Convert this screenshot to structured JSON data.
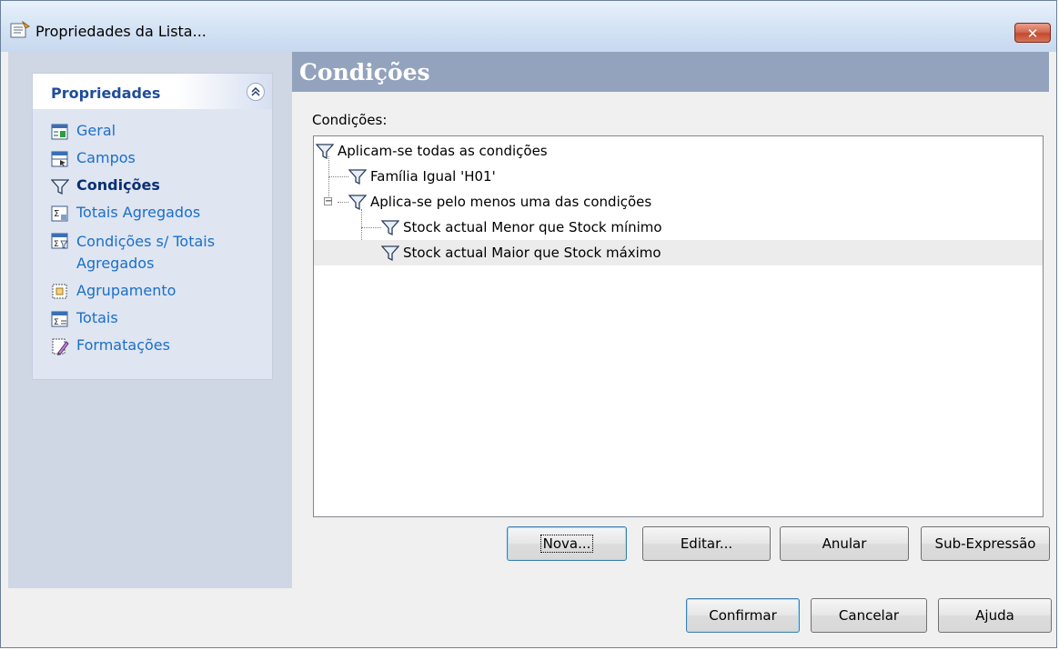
{
  "window": {
    "title": "Propriedades da Lista...",
    "close_glyph": "✕"
  },
  "header": {
    "title": "Condições"
  },
  "sidebar": {
    "panel_title": "Propriedades",
    "collapse_glyph": "≪",
    "items": [
      {
        "label": "Geral",
        "icon": "general-icon"
      },
      {
        "label": "Campos",
        "icon": "fields-icon"
      },
      {
        "label": "Condições",
        "icon": "filter-icon",
        "active": true
      },
      {
        "label": "Totais Agregados",
        "icon": "aggregate-totals-icon"
      },
      {
        "label": "Condições s/ Totais Agregados",
        "icon": "aggregate-conditions-icon"
      },
      {
        "label": "Agrupamento",
        "icon": "grouping-icon"
      },
      {
        "label": "Totais",
        "icon": "totals-icon"
      },
      {
        "label": "Formatações",
        "icon": "formatting-icon"
      }
    ]
  },
  "conditions": {
    "label": "Condições:",
    "tree": [
      {
        "text": "Aplicam-se todas as condições",
        "level": 0
      },
      {
        "text": "Família Igual 'H01'",
        "level": 1
      },
      {
        "text": "Aplica-se pelo menos uma das condições",
        "level": 1,
        "expander": "−"
      },
      {
        "text": "Stock actual Menor que Stock mínimo",
        "level": 2
      },
      {
        "text": "Stock actual Maior que Stock máximo",
        "level": 2,
        "selected": true
      }
    ]
  },
  "actions": {
    "new": "Nova...",
    "edit": "Editar...",
    "delete": "Anular",
    "sub_expression": "Sub-Expressão"
  },
  "footer": {
    "confirm": "Confirmar",
    "cancel": "Cancelar",
    "help": "Ajuda"
  },
  "colors": {
    "header_strip": "#93a3bd",
    "sidebar_bg": "#cfd6e4",
    "link": "#1a6fc9",
    "active_link": "#0a2f73",
    "close_button": "#c24a2f"
  }
}
